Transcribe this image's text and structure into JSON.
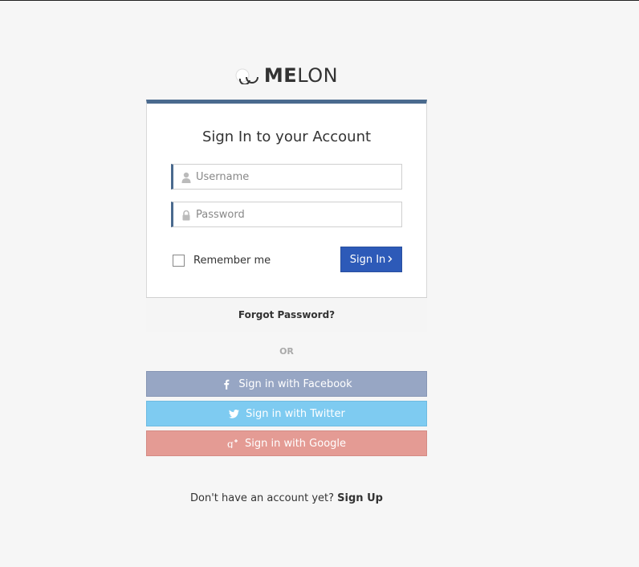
{
  "logo": {
    "text_strong": "ME",
    "text_rest": "LON"
  },
  "login_card": {
    "title": "Sign In to your Account",
    "username": {
      "placeholder": "Username",
      "value": ""
    },
    "password": {
      "placeholder": "Password",
      "value": ""
    },
    "remember_label": "Remember me",
    "remember_checked": false,
    "signin_label": "Sign In",
    "forgot_label": "Forgot Password?"
  },
  "separator": "OR",
  "social": {
    "facebook_label": "Sign in with Facebook",
    "twitter_label": "Sign in with Twitter",
    "google_label": "Sign in with Google"
  },
  "signup": {
    "prompt": "Don't have an account yet?",
    "link_label": "Sign Up"
  },
  "colors": {
    "accent": "#4a6a8e",
    "primary_button": "#2d5ab8",
    "facebook": "#97a6c4",
    "twitter": "#7ecbf1",
    "google": "#e49b94",
    "background": "#f6f6f6"
  },
  "icons": {
    "logo": "cloud-logo-icon",
    "username": "user-icon",
    "password": "lock-icon",
    "signin": "chevron-right-icon",
    "facebook": "facebook-icon",
    "twitter": "twitter-icon",
    "google": "google-plus-icon"
  }
}
